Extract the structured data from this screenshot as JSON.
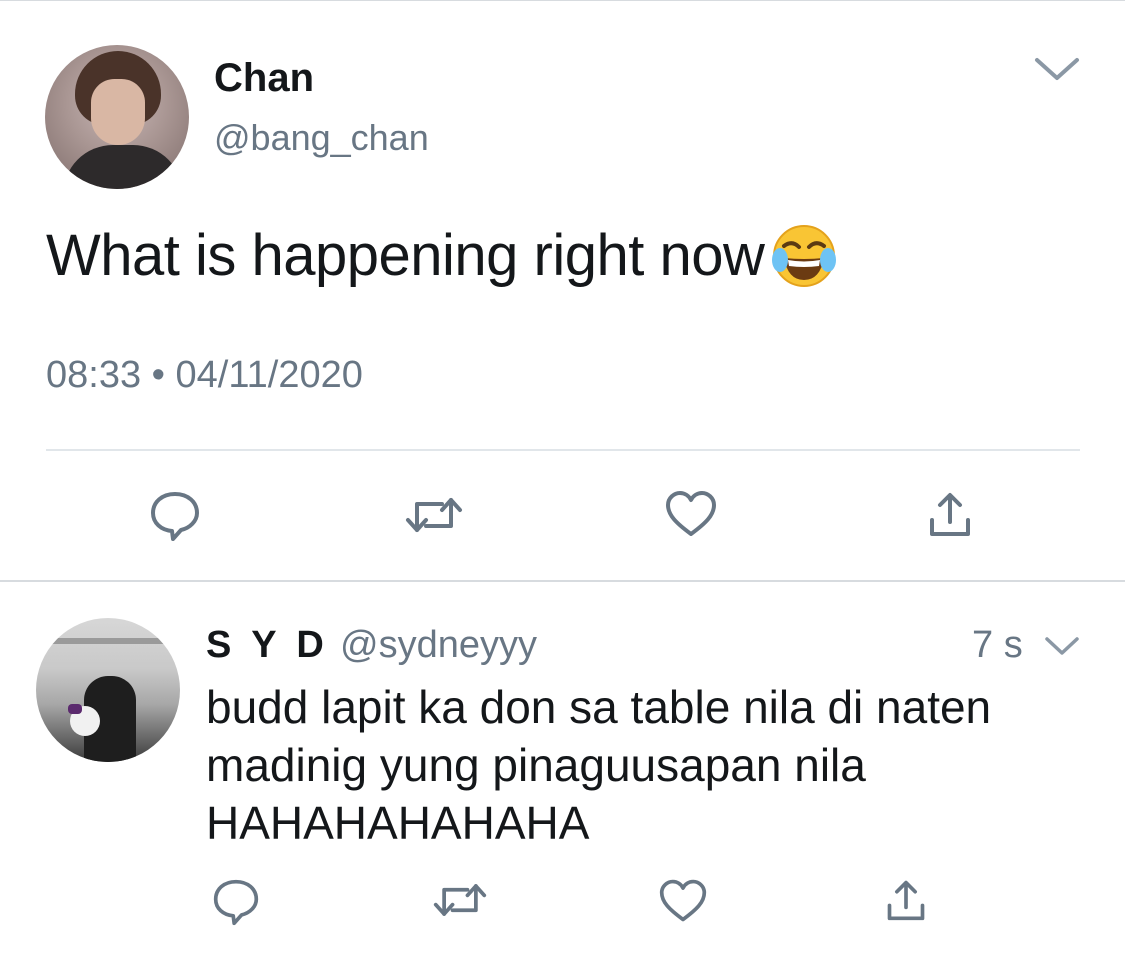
{
  "colors": {
    "primary_text": "#14171a",
    "secondary_text": "#687684",
    "icon": "#687684",
    "divider": "#e1e6ea"
  },
  "main_tweet": {
    "author": {
      "name": "Chan",
      "handle": "@bang_chan"
    },
    "text": "What is happening right now",
    "emoji": "face-with-tears-of-joy",
    "timestamp": "08:33 • 04/11/2020",
    "actions": [
      "reply-icon",
      "retweet-icon",
      "like-icon",
      "share-icon"
    ]
  },
  "reply_tweet": {
    "author": {
      "name": "S Y D",
      "handle": "@sydneyyy"
    },
    "time": "7 s",
    "text_lines": [
      "budd lapit ka don sa table nila di naten",
      "madinig yung pinaguusapan nila",
      "HAHAHAHAHAHA"
    ],
    "actions": [
      "reply-icon",
      "retweet-icon",
      "like-icon",
      "share-icon"
    ]
  }
}
